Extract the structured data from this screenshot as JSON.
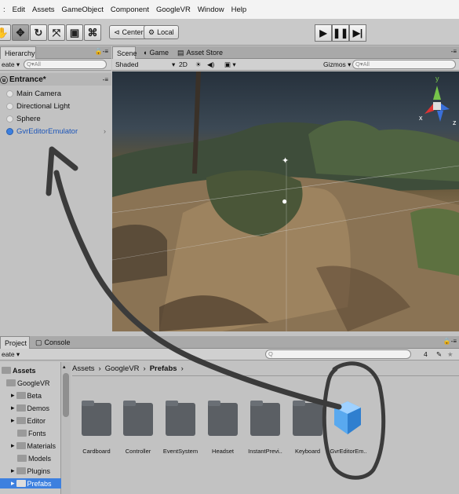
{
  "menu": [
    "Edit",
    "Assets",
    "GameObject",
    "Component",
    "GoogleVR",
    "Window",
    "Help"
  ],
  "toolbar": {
    "center_label": "Center",
    "local_label": "Local"
  },
  "hierarchy": {
    "tab_label": "Hierarchy",
    "create_label": "eate",
    "search_placeholder": "Q▾All",
    "scene_name": "Entrance*",
    "items": [
      "Main Camera",
      "Directional Light",
      "Sphere",
      "GvrEditorEmulator"
    ]
  },
  "scene": {
    "tabs": [
      "Scene",
      "Game",
      "Asset Store"
    ],
    "shading": "Shaded",
    "mode_2d": "2D",
    "gizmos_label": "Gizmos",
    "search_placeholder": "Q▾All",
    "gizmo_axes": {
      "y": "y",
      "x": "x",
      "z": "z"
    }
  },
  "project": {
    "tabs": [
      "Project",
      "Console"
    ],
    "create_label": "eate",
    "search_placeholder": "Q",
    "breadcrumb": [
      "Assets",
      "GoogleVR",
      "Prefabs"
    ],
    "tree": [
      "Assets",
      "GoogleVR",
      "Beta",
      "Demos",
      "Editor",
      "Fonts",
      "Materials",
      "Models",
      "Plugins",
      "Prefabs"
    ],
    "assets": [
      "Cardboard",
      "Controller",
      "EventSystem",
      "Headset",
      "InstantPrevi..",
      "Keyboard",
      "GvrEditorEm.."
    ],
    "count_label": "4"
  },
  "colors": {
    "selection": "#3d80df",
    "annotation": "#3b3b3b",
    "prefab_blue": "#59a9ef"
  }
}
